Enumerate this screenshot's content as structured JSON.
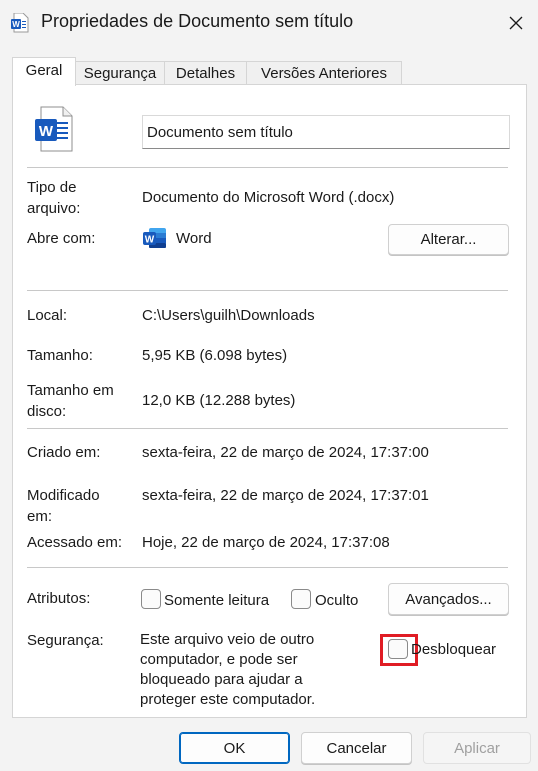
{
  "window": {
    "title": "Propriedades de Documento sem título",
    "icon": "word-icon"
  },
  "tabs": [
    {
      "label": "Geral",
      "active": true
    },
    {
      "label": "Segurança",
      "active": false
    },
    {
      "label": "Detalhes",
      "active": false
    },
    {
      "label": "Versões Anteriores",
      "active": false
    }
  ],
  "general": {
    "file_name": "Documento sem título",
    "file_type_label": "Tipo de arquivo:",
    "file_type_label_line1": "Tipo de",
    "file_type_label_line2": "arquivo:",
    "file_type_value": "Documento do Microsoft Word (.docx)",
    "opens_with_label": "Abre com:",
    "opens_with_app": "Word",
    "change_button": "Alterar...",
    "location_label": "Local:",
    "location_value": "C:\\Users\\guilh\\Downloads",
    "size_label": "Tamanho:",
    "size_value": "5,95 KB (6.098 bytes)",
    "size_on_disk_label_line1": "Tamanho em",
    "size_on_disk_label_line2": "disco:",
    "size_on_disk_value": "12,0 KB (12.288 bytes)",
    "created_label": "Criado em:",
    "created_value": "sexta-feira, 22 de março de 2024, 17:37:00",
    "modified_label_line1": "Modificado",
    "modified_label_line2": "em:",
    "modified_value": "sexta-feira, 22 de março de 2024, 17:37:01",
    "accessed_label": "Acessado em:",
    "accessed_value": "Hoje, 22 de março de 2024, 17:37:08",
    "attributes_label": "Atributos:",
    "readonly_label": "Somente leitura",
    "readonly_checked": false,
    "hidden_label": "Oculto",
    "hidden_checked": false,
    "advanced_button": "Avançados...",
    "security_label": "Segurança:",
    "security_text_lines": [
      "Este arquivo veio de outro",
      "computador, e pode ser",
      "bloqueado para ajudar a",
      "proteger este computador."
    ],
    "unblock_label": "Desbloquear",
    "unblock_checked": false
  },
  "footer": {
    "ok": "OK",
    "cancel": "Cancelar",
    "apply": "Aplicar"
  },
  "colors": {
    "word_blue": "#185abd",
    "highlight_red": "#e01c24",
    "primary_border": "#0067c0"
  }
}
